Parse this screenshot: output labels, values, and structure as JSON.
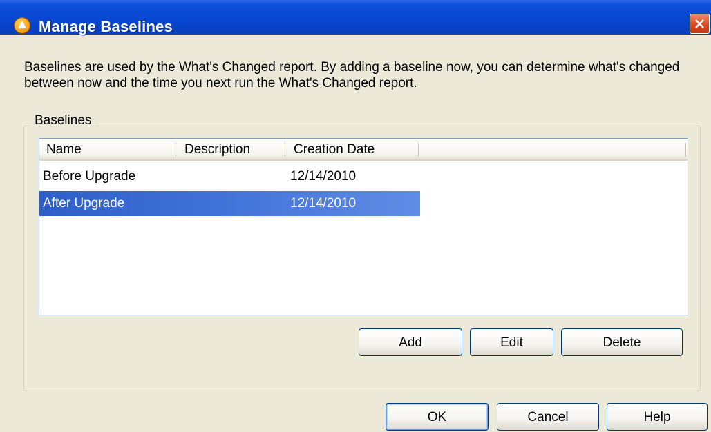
{
  "window": {
    "title": "Manage Baselines",
    "app_icon": "app-logo-icon",
    "close_icon": "close-icon"
  },
  "intro_text": "Baselines are used by the What's Changed report.  By adding a baseline now, you can determine what's changed between now and the time you next run the What's Changed report.",
  "group": {
    "label": "Baselines",
    "columns": [
      "Name",
      "Description",
      "Creation Date"
    ],
    "rows": [
      {
        "name": "Before Upgrade",
        "description": "",
        "date": "12/14/2010",
        "selected": false
      },
      {
        "name": "After Upgrade",
        "description": "",
        "date": "12/14/2010",
        "selected": true
      }
    ],
    "buttons": {
      "add": "Add",
      "edit": "Edit",
      "delete": "Delete"
    }
  },
  "footer": {
    "ok": "OK",
    "cancel": "Cancel",
    "help": "Help"
  },
  "colors": {
    "titlebar": "#0846d0",
    "selection": "#3d6fd6",
    "dialog_bg": "#ece9d8"
  }
}
